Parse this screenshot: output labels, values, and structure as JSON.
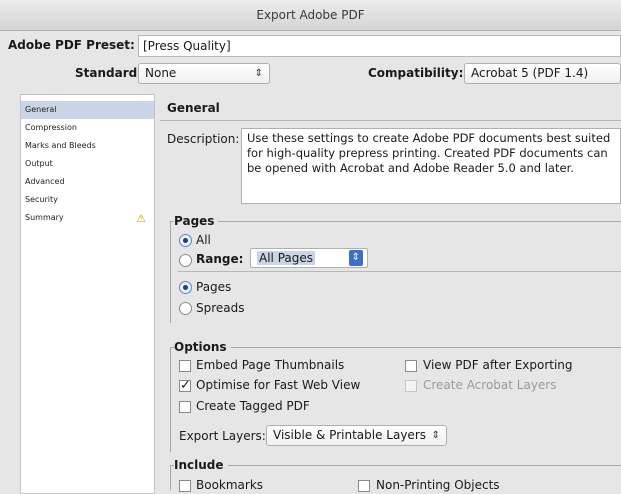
{
  "window": {
    "title": "Export Adobe PDF"
  },
  "header": {
    "preset_label": "Adobe PDF Preset:",
    "preset_value": "[Press Quality]",
    "standard_label": "Standard:",
    "standard_value": "None",
    "compatibility_label": "Compatibility:",
    "compatibility_value": "Acrobat 5 (PDF 1.4)"
  },
  "sidebar": {
    "items": [
      {
        "label": "General"
      },
      {
        "label": "Compression"
      },
      {
        "label": "Marks and Bleeds"
      },
      {
        "label": "Output"
      },
      {
        "label": "Advanced"
      },
      {
        "label": "Security"
      },
      {
        "label": "Summary",
        "warning_icon": "warning-icon"
      }
    ],
    "selected": "General"
  },
  "general": {
    "heading": "General",
    "description_label": "Description:",
    "description_text": "Use these settings to create Adobe PDF documents best suited for high-quality prepress printing.  Created PDF documents can be opened with Acrobat and Adobe Reader 5.0 and later."
  },
  "pages": {
    "title": "Pages",
    "all_label": "All",
    "range_label": "Range:",
    "range_value": "All Pages",
    "pages_label": "Pages",
    "spreads_label": "Spreads"
  },
  "options": {
    "title": "Options",
    "embed_thumbnails": "Embed Page Thumbnails",
    "optimise_web": "Optimise for Fast Web View",
    "tagged_pdf": "Create Tagged PDF",
    "view_after": "View PDF after Exporting",
    "acrobat_layers": "Create Acrobat Layers",
    "export_layers_label": "Export Layers:",
    "export_layers_value": "Visible & Printable Layers"
  },
  "include": {
    "title": "Include",
    "bookmarks": "Bookmarks",
    "non_printing": "Non-Printing Objects"
  },
  "colors": {
    "selection": "#c9d4e6",
    "warning": "#d9a000"
  }
}
